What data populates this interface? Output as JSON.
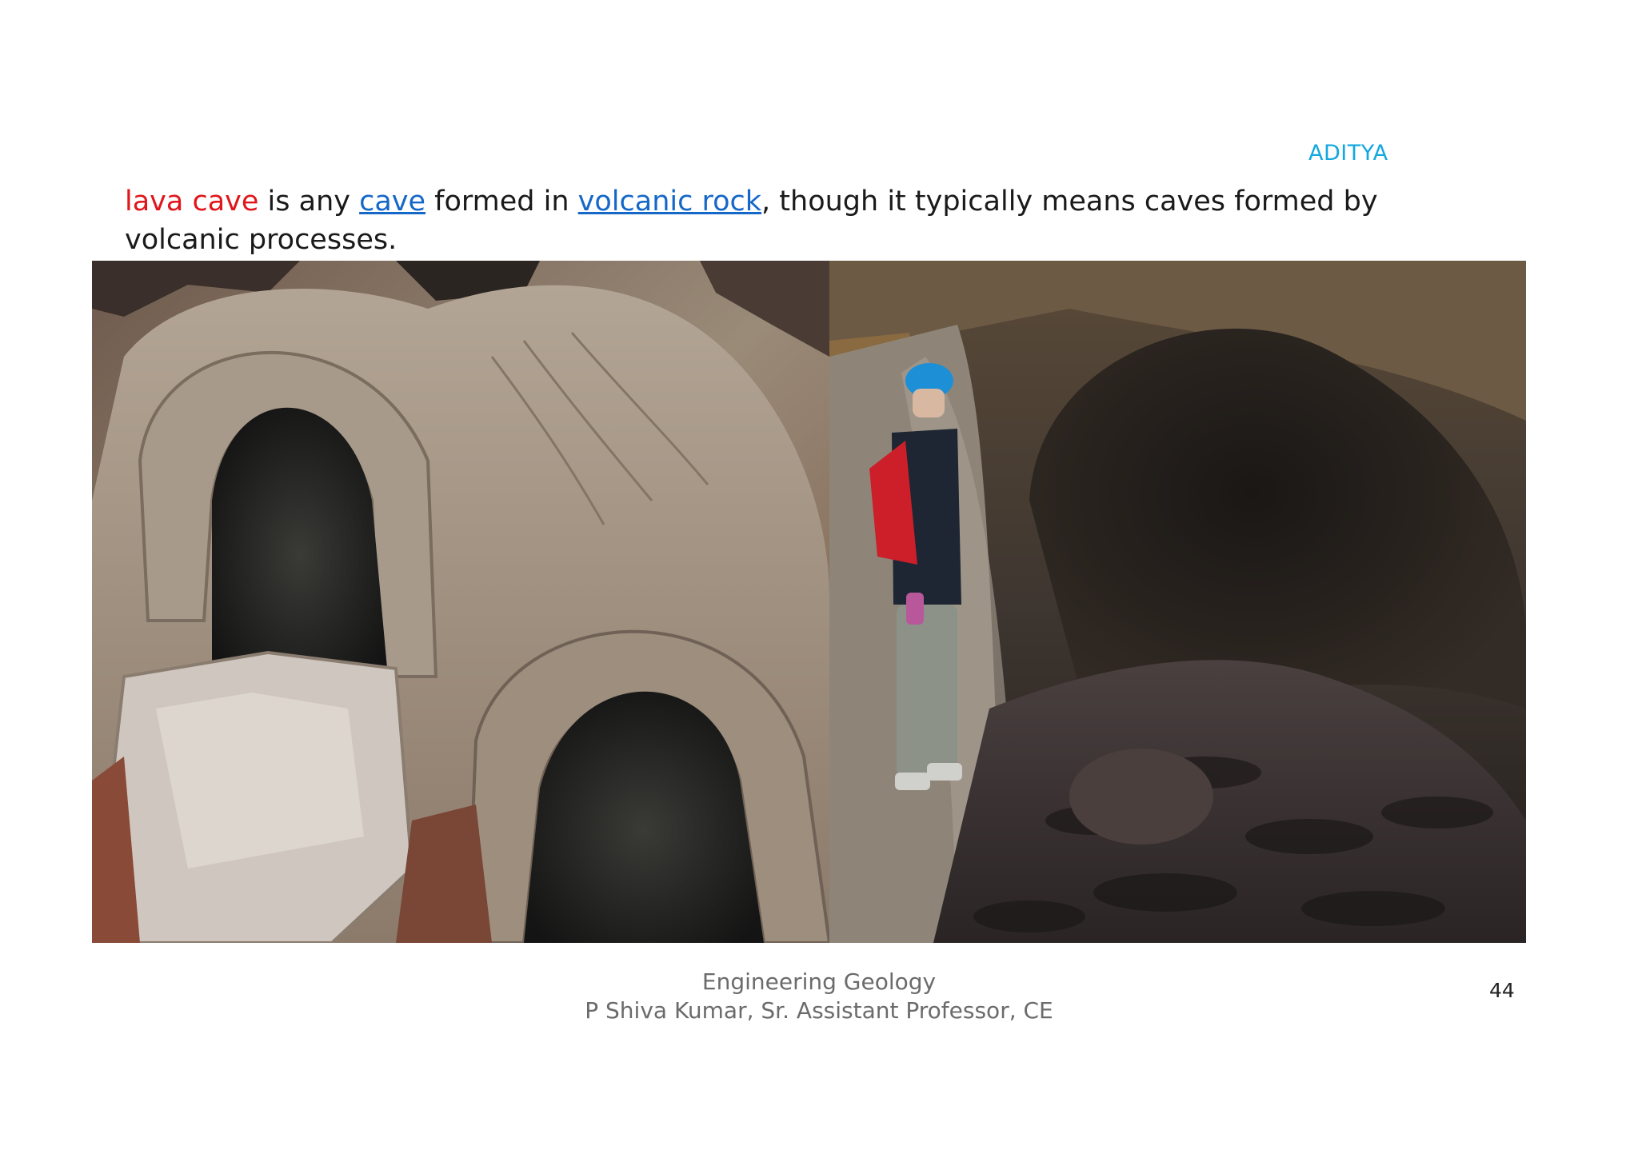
{
  "header": {
    "brand": "ADITYA"
  },
  "intro": {
    "term": "lava cave",
    "text_1": " is any ",
    "link_1": "cave",
    "text_2": " formed in ",
    "link_2": "volcanic rock",
    "text_3": ", though it typically means caves formed by volcanic processes."
  },
  "images": {
    "left": {
      "icon": "lava-cave-arches-photo"
    },
    "right": {
      "icon": "lava-tube-explorer-photo"
    }
  },
  "footer": {
    "course": "Engineering Geology",
    "author": "P Shiva Kumar, Sr. Assistant  Professor, CE",
    "page_number": "44"
  },
  "colors": {
    "brand": "#12a8e0",
    "term": "#e0161b",
    "link": "#1668c8",
    "footer_text": "#6b6b6b"
  }
}
